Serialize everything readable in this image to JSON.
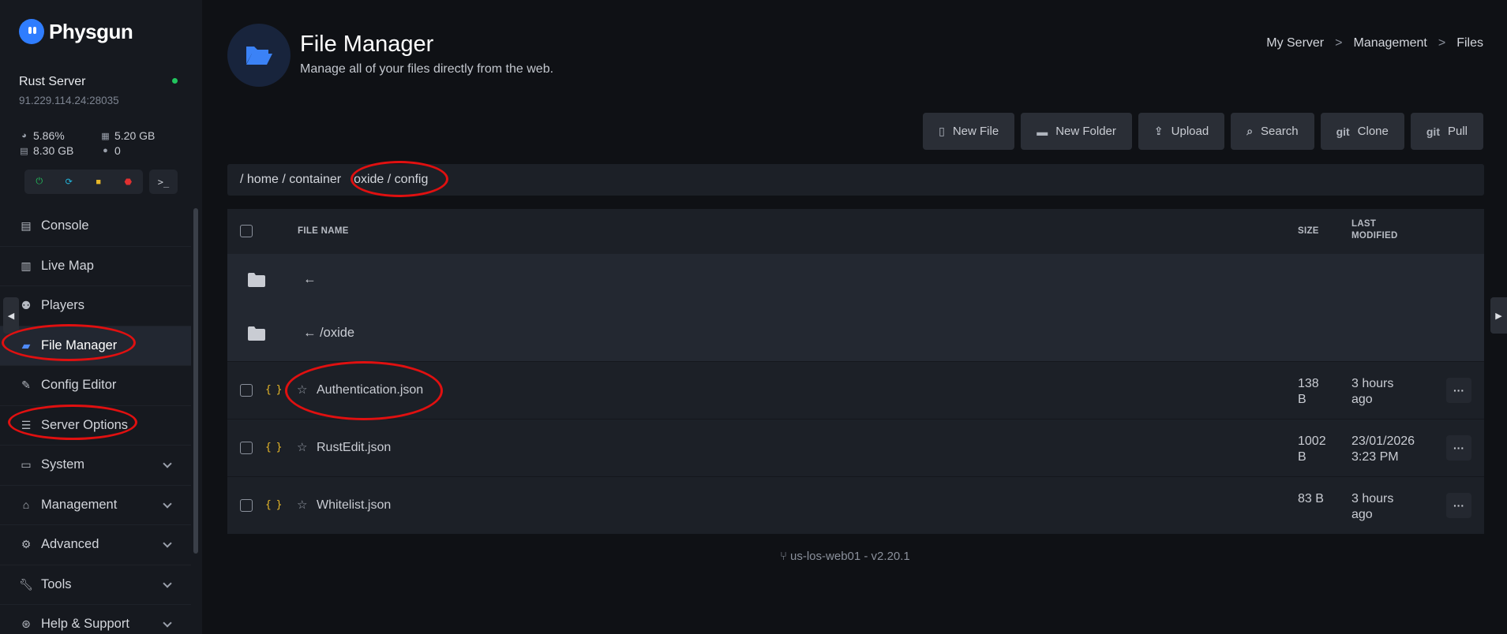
{
  "app": {
    "name": "Physgun"
  },
  "server": {
    "name": "Rust Server",
    "address": "91.229.114.24:28035",
    "cpu": "5.86%",
    "memory": "5.20 GB",
    "disk": "8.30 GB",
    "players": "0",
    "status_color": "#22c55e"
  },
  "controls": {
    "terminal_label": ">_"
  },
  "nav": {
    "console": "Console",
    "live_map": "Live Map",
    "players": "Players",
    "file_manager": "File Manager",
    "config_editor": "Config Editor",
    "server_options": "Server Options",
    "system": "System",
    "management": "Management",
    "advanced": "Advanced",
    "tools": "Tools",
    "help_support": "Help & Support"
  },
  "header": {
    "title": "File Manager",
    "subtitle": "Manage all of your files directly from the web.",
    "breadcrumb": {
      "server": "My Server",
      "section": "Management",
      "page": "Files",
      "sep": ">"
    }
  },
  "toolbar": {
    "new_file": "New File",
    "new_folder": "New Folder",
    "upload": "Upload",
    "search": "Search",
    "clone": "Clone",
    "pull": "Pull",
    "git_label": "git"
  },
  "path": {
    "prefix": "/ home / container",
    "highlighted": "oxide / config"
  },
  "table": {
    "col_name": "FILE NAME",
    "col_size": "SIZE",
    "col_modified_1": "LAST",
    "col_modified_2": "MODIFIED",
    "back": "←",
    "back_oxide": "← /oxide",
    "files": [
      {
        "name": "Authentication.json",
        "size_1": "138",
        "size_2": "B",
        "mod_1": "3 hours",
        "mod_2": "ago"
      },
      {
        "name": "RustEdit.json",
        "size_1": "1002",
        "size_2": "B",
        "mod_1": "23/01/2026",
        "mod_2": "3:23 PM"
      },
      {
        "name": "Whitelist.json",
        "size_1": "83 B",
        "size_2": "",
        "mod_1": "3 hours",
        "mod_2": "ago"
      }
    ],
    "more_label": "···",
    "json_icon": "{ }"
  },
  "footer": {
    "version": "us-los-web01 - v2.20.1"
  },
  "colors": {
    "accent": "#2f7dff",
    "annotation": "#e01010",
    "json_icon": "#e8b828"
  }
}
